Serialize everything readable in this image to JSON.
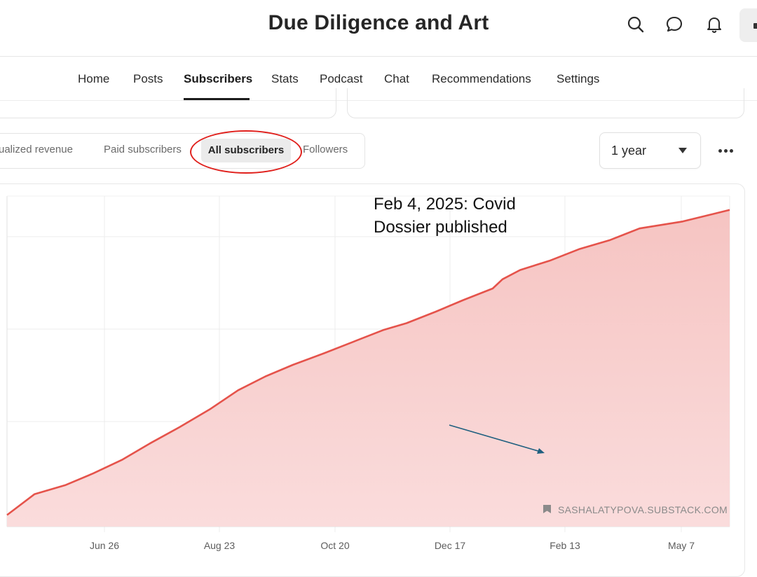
{
  "header": {
    "title": "Due Diligence and Art",
    "icons": [
      "search-icon",
      "chat-bubble-icon",
      "bell-icon"
    ]
  },
  "nav": {
    "items": [
      "Home",
      "Posts",
      "Subscribers",
      "Stats",
      "Podcast",
      "Chat",
      "Recommendations",
      "Settings"
    ],
    "active": "Subscribers"
  },
  "filters": {
    "annualized_revenue": "ualized revenue",
    "paid_subscribers": "Paid subscribers",
    "all_subscribers": "All subscribers",
    "followers": "Followers"
  },
  "range_select": {
    "value": "1 year"
  },
  "colors": {
    "line": "#e5534b",
    "fill": "#f6c9c7",
    "highlight": "#e0201c",
    "arrow": "#1f5f7f"
  },
  "annotation": {
    "text": "Feb 4, 2025: Covid\nDossier published"
  },
  "chart_data": {
    "type": "area",
    "title": "",
    "xlabel": "",
    "ylabel": "",
    "x_ticks": [
      "Jun 26",
      "Aug 23",
      "Oct 20",
      "Dec 17",
      "Feb 13",
      "May 7"
    ],
    "x_range": [
      "2024-05-27",
      "2025-05-31"
    ],
    "y_tick_labels": [],
    "grid": true,
    "watermark": "SASHALATYPOVA.SUBSTACK.COM",
    "series": [
      {
        "x": [
          "2024-05-27",
          "2024-06-10",
          "2024-06-26",
          "2024-07-10",
          "2024-07-25",
          "2024-08-08",
          "2024-08-23",
          "2024-09-08",
          "2024-09-22",
          "2024-10-06",
          "2024-10-20",
          "2024-11-05",
          "2024-11-20",
          "2024-12-05",
          "2024-12-17",
          "2025-01-01",
          "2025-01-15",
          "2025-01-30",
          "2025-02-04",
          "2025-02-13",
          "2025-02-28",
          "2025-03-15",
          "2025-03-31",
          "2025-04-15",
          "2025-05-07",
          "2025-05-31"
        ],
        "y": [
          0.05,
          0.14,
          0.18,
          0.23,
          0.29,
          0.36,
          0.43,
          0.51,
          0.59,
          0.65,
          0.7,
          0.75,
          0.8,
          0.85,
          0.88,
          0.93,
          0.98,
          1.03,
          1.07,
          1.11,
          1.15,
          1.2,
          1.24,
          1.29,
          1.32,
          1.37
        ]
      }
    ]
  }
}
